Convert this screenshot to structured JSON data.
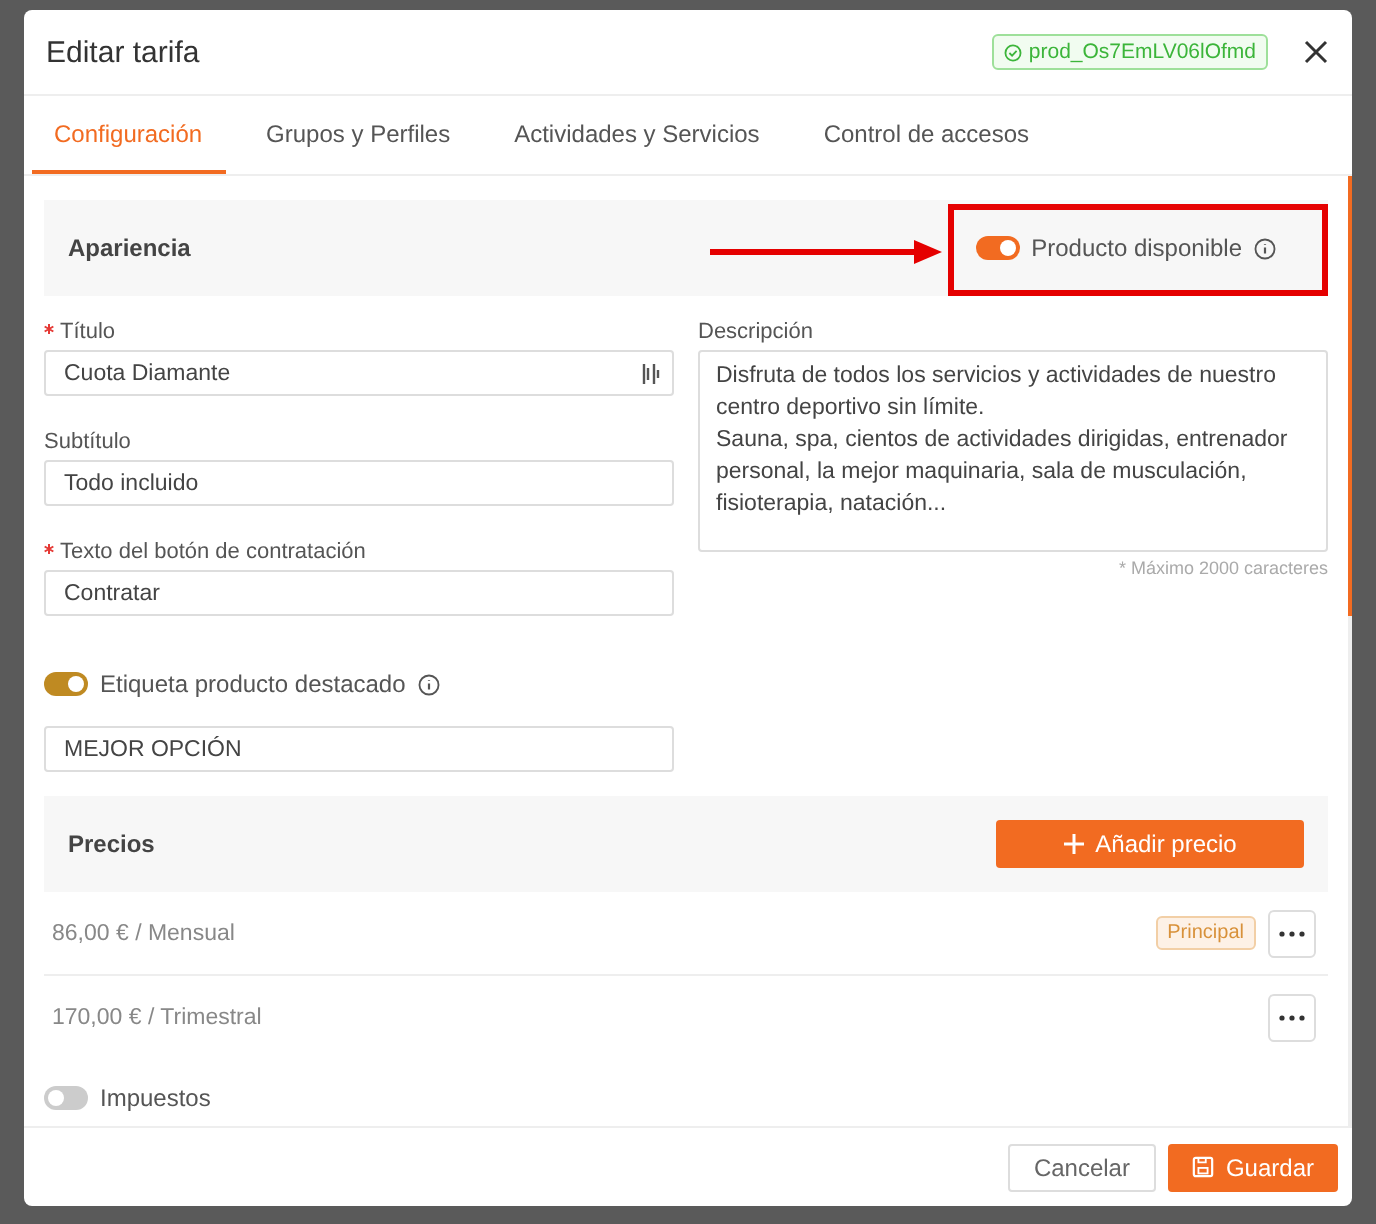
{
  "dialog": {
    "title": "Editar tarifa",
    "product_id": "prod_Os7EmLV06lOfmd"
  },
  "tabs": [
    {
      "label": "Configuración",
      "selected": true
    },
    {
      "label": "Grupos y Perfiles",
      "selected": false
    },
    {
      "label": "Actividades y Servicios",
      "selected": false
    },
    {
      "label": "Control de accesos",
      "selected": false
    }
  ],
  "appearance": {
    "title": "Apariencia",
    "available_toggle": {
      "label": "Producto disponible",
      "on": true,
      "highlighted": true
    }
  },
  "fields": [
    {
      "label": "Título",
      "required": true,
      "value": "Cuota Diamante",
      "has_icon": true
    },
    {
      "label": "Subtítulo",
      "required": false,
      "value": "Todo incluido",
      "has_icon": false
    },
    {
      "label": "Texto del botón de contratación",
      "required": true,
      "value": "Contratar",
      "has_icon": false
    }
  ],
  "description": {
    "label": "Descripción",
    "value": "Disfruta de todos los servicios y actividades de nuestro centro deportivo sin límite.\nSauna, spa, cientos de actividades dirigidas, entrenador personal, la mejor maquinaria, sala de musculación, fisioterapia, natación...",
    "hint": "* Máximo 2000 caracteres"
  },
  "featured": {
    "label": "Etiqueta producto destacado",
    "on": true,
    "value": "MEJOR OPCIÓN"
  },
  "prices": {
    "title": "Precios",
    "add_button": "Añadir precio",
    "rows": [
      {
        "text": "86,00 € / Mensual",
        "badge": "Principal"
      },
      {
        "text": "170,00 € / Trimestral"
      }
    ]
  },
  "taxes": {
    "label": "Impuestos",
    "on": false
  },
  "footer": {
    "cancel": "Cancelar",
    "save": "Guardar"
  }
}
